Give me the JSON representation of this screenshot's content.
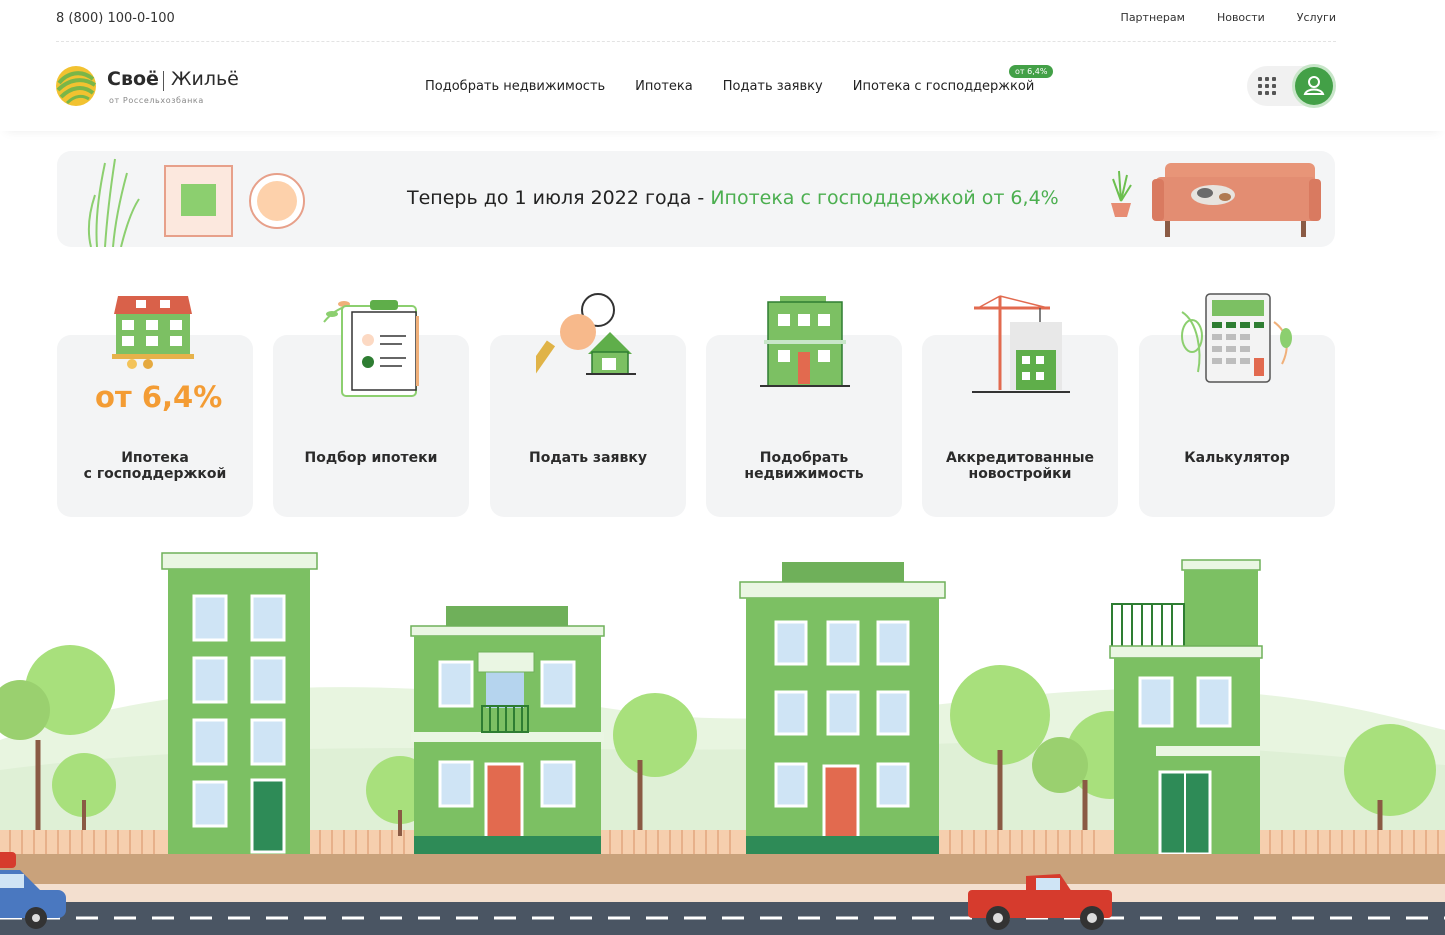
{
  "topbar": {
    "phone": "8 (800) 100-0-100",
    "links": [
      "Партнерам",
      "Новости",
      "Услуги"
    ]
  },
  "logo": {
    "word1": "Своё",
    "word2": "Жильё",
    "sub": "от Россельхозбанка"
  },
  "nav": {
    "items": [
      "Подобрать недвижимость",
      "Ипотека",
      "Подать заявку",
      "Ипотека с господдержкой"
    ],
    "badge": "от 6,4%"
  },
  "icons": {
    "apps": "grid-icon",
    "profile": "user-icon"
  },
  "banner": {
    "text_plain": "Теперь до 1 июля 2022 года - ",
    "text_highlight": "Ипотека с господдержкой от 6,4%"
  },
  "cards": [
    {
      "label": "Ипотека\nс господдержкой",
      "rate": "от 6,4%",
      "icon": "house-icon"
    },
    {
      "label": "Подбор ипотеки",
      "icon": "clipboard-icon"
    },
    {
      "label": "Подать заявку",
      "icon": "key-icon"
    },
    {
      "label": "Подобрать\nнедвижимость",
      "icon": "building-icon"
    },
    {
      "label": "Аккредитованные\nновостройки",
      "icon": "crane-icon"
    },
    {
      "label": "Калькулятор",
      "icon": "calculator-icon"
    }
  ],
  "colors": {
    "brand_green": "#43a047",
    "accent_orange": "#f39c34",
    "building_green": "#7cc063"
  }
}
